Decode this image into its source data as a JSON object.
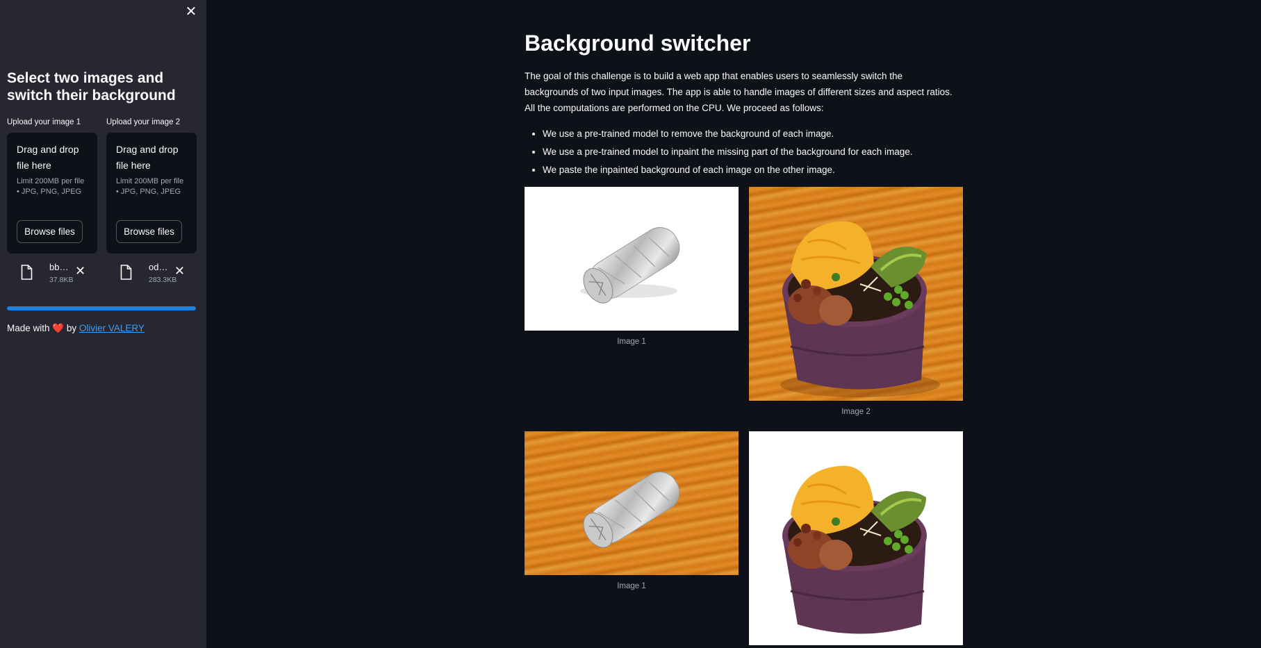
{
  "sidebar": {
    "close_icon": "close-icon",
    "title": "Select two images and switch their background",
    "uploaders": [
      {
        "label": "Upload your image 1",
        "drop_text": "Drag and drop file here",
        "limit_text": "Limit 200MB per file • JPG, PNG, JPEG",
        "button_label": "Browse files",
        "file_name": "bb…",
        "file_size": "37.8KB"
      },
      {
        "label": "Upload your image 2",
        "drop_text": "Drag and drop file here",
        "limit_text": "Limit 200MB per file • JPG, PNG, JPEG",
        "button_label": "Browse files",
        "file_name": "od…",
        "file_size": "283.3KB"
      }
    ],
    "progress": 1.0,
    "footer": {
      "prefix": "Made with",
      "heart": "❤️",
      "by": "by",
      "author": "Olivier VALERY"
    }
  },
  "main": {
    "title": "Background switcher",
    "intro": "The goal of this challenge is to build a web app that enables users to seamlessly switch the backgrounds of two input images. The app is able to handle images of different sizes and aspect ratios. All the computations are performed on the CPU. We proceed as follows:",
    "bullets": [
      "We use a pre-trained model to remove the background of each image.",
      "We use a pre-trained model to inpaint the missing part of the background for each image.",
      "We paste the inpainted background of each image on the other image."
    ],
    "images": [
      {
        "caption": "Image 1",
        "content": "burrito-on-white"
      },
      {
        "caption": "Image 2",
        "content": "food-bowl-on-wood"
      },
      {
        "caption": "Image 1",
        "content": "burrito-on-wood"
      },
      {
        "caption": "",
        "content": "food-bowl-on-white"
      }
    ]
  },
  "colors": {
    "background": "#0e1117",
    "sidebar": "#262730",
    "accent": "#1c83e1",
    "link": "#3b9eff"
  }
}
